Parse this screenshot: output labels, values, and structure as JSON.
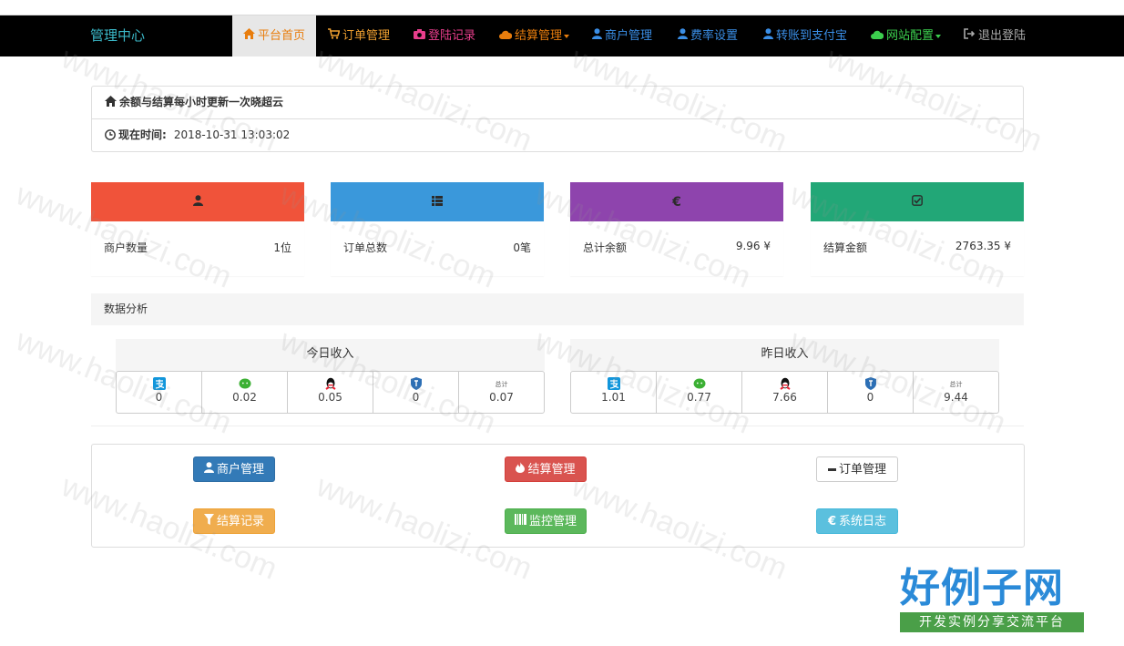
{
  "colors": {
    "nav_bg": "#000000",
    "red": "#f0533a",
    "blue": "#3a98db",
    "purple": "#8e44ad",
    "green": "#22a777",
    "btn_primary": "#337ab7",
    "btn_danger": "#d9534f",
    "btn_warning": "#f0ad4e",
    "btn_success": "#5cb85c",
    "btn_info": "#5bc0de"
  },
  "nav": {
    "brand": "管理中心",
    "items": [
      {
        "label": "平台首页",
        "icon": "home-icon",
        "color": "#e87d0d",
        "active": true
      },
      {
        "label": "订单管理",
        "icon": "cart-icon",
        "color": "#f0a030"
      },
      {
        "label": "登陆记录",
        "icon": "camera-icon",
        "color": "#e83e8c"
      },
      {
        "label": "结算管理",
        "icon": "cloud-icon",
        "color": "#e87d0d",
        "caret": true
      },
      {
        "label": "商户管理",
        "icon": "user-icon",
        "color": "#3a8ee6"
      },
      {
        "label": "费率设置",
        "icon": "user-icon",
        "color": "#3a8ee6"
      },
      {
        "label": "转账到支付宝",
        "icon": "user-icon",
        "color": "#3a8ee6"
      },
      {
        "label": "网站配置",
        "icon": "cloud-icon",
        "color": "#3ccf4e",
        "caret": true
      },
      {
        "label": "退出登陆",
        "icon": "logout-icon",
        "color": "#aaaaaa"
      }
    ]
  },
  "info": {
    "notice": "余额与结算每小时更新一次晓超云",
    "time_label": "现在时间:",
    "time_value": "2018-10-31 13:03:02"
  },
  "stats": [
    {
      "label": "商户数量",
      "value": "1位",
      "icon": "user-icon",
      "color": "#f0533a"
    },
    {
      "label": "订单总数",
      "value": "0笔",
      "icon": "list-icon",
      "color": "#3a98db"
    },
    {
      "label": "总计余额",
      "value": "9.96 ¥",
      "icon": "euro-icon",
      "color": "#8e44ad"
    },
    {
      "label": "结算金额",
      "value": "2763.35 ¥",
      "icon": "check-icon",
      "color": "#22a777"
    }
  ],
  "analysis": {
    "title": "数据分析",
    "today": {
      "title": "今日收入",
      "values": [
        "0",
        "0.02",
        "0.05",
        "0",
        "0.07"
      ]
    },
    "yesterday": {
      "title": "昨日收入",
      "values": [
        "1.01",
        "0.77",
        "7.66",
        "0",
        "9.44"
      ]
    },
    "total_label": "总计",
    "channel_icons": [
      "alipay-icon",
      "wechat-icon",
      "qq-icon",
      "shield-icon",
      "total-icon"
    ]
  },
  "buttons": [
    {
      "label": "商户管理",
      "icon": "user-icon",
      "style": "primary"
    },
    {
      "label": "结算管理",
      "icon": "fire-icon",
      "style": "danger"
    },
    {
      "label": "订单管理",
      "icon": "minus-icon",
      "style": "default"
    },
    {
      "label": "结算记录",
      "icon": "filter-icon",
      "style": "warning"
    },
    {
      "label": "监控管理",
      "icon": "barcode-icon",
      "style": "success"
    },
    {
      "label": "系统日志",
      "icon": "euro-icon",
      "style": "info"
    }
  ],
  "watermark": "www.haolizi.com",
  "logo": {
    "main": "好例子网",
    "sub": "开发实例分享交流平台"
  }
}
